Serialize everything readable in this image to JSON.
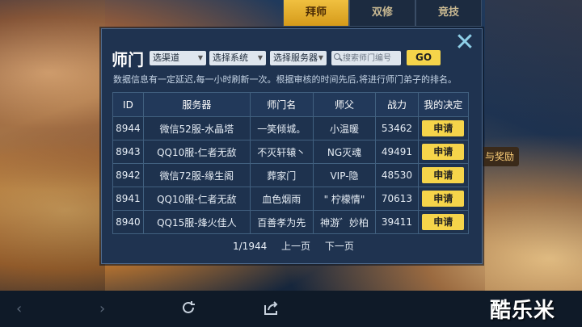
{
  "top_tabs": [
    {
      "label": "拜师",
      "active": true
    },
    {
      "label": "双修",
      "active": false
    },
    {
      "label": "竞技",
      "active": false
    }
  ],
  "side_button": "与奖励",
  "dialog": {
    "title": "师门",
    "filters": {
      "channel": "选渠道",
      "system": "选择系统",
      "server": "选择服务器",
      "search_placeholder": "搜索师门编号",
      "go_label": "GO"
    },
    "notice": "数据信息有一定延迟,每一小时刷新一次。根据审核的时间先后,将进行师门弟子的排名。",
    "table": {
      "headers": [
        "ID",
        "服务器",
        "师门名",
        "师父",
        "战力",
        "我的决定"
      ],
      "rows": [
        {
          "id": "8944",
          "server": "微信52服-水晶塔",
          "sect": "一笑倾城。",
          "master": "小温暖",
          "power": "53462",
          "action": "申请"
        },
        {
          "id": "8943",
          "server": "QQ10服-仁者无敌",
          "sect": "不灭轩辕丶",
          "master": "NG灭魂",
          "power": "49491",
          "action": "申请"
        },
        {
          "id": "8942",
          "server": "微信72服-缘生阁",
          "sect": "葬家门",
          "master": "VIP-隐",
          "power": "48530",
          "action": "申请"
        },
        {
          "id": "8941",
          "server": "QQ10服-仁者无敌",
          "sect": "血色烟雨",
          "master": "\" 柠檬情\"",
          "power": "70613",
          "action": "申请"
        },
        {
          "id": "8940",
          "server": "QQ15服-烽火佳人",
          "sect": "百善孝为先",
          "master": "神游゛妙柏",
          "power": "39411",
          "action": "申请"
        }
      ]
    },
    "pager": {
      "page": "1/1944",
      "prev": "上一页",
      "next": "下一页"
    }
  },
  "browser_bar": {
    "icons": [
      "back-arrow-icon",
      "forward-arrow-icon",
      "refresh-icon",
      "share-icon"
    ]
  },
  "watermark": "酷乐米",
  "colors": {
    "accent_yellow": "#f5d44a",
    "panel_bg": "#1f3350",
    "close_cyan": "#8fd0e8"
  }
}
